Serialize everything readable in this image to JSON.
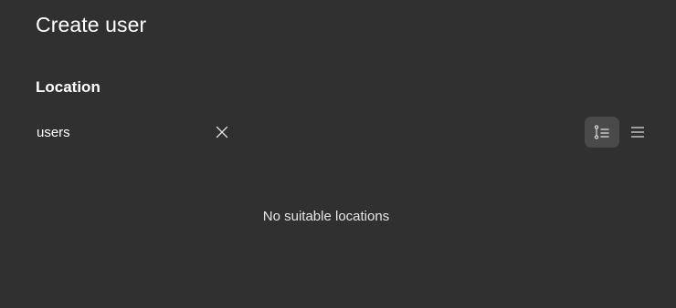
{
  "dialog": {
    "title": "Create user"
  },
  "location": {
    "heading": "Location",
    "search": {
      "value": "users",
      "placeholder": ""
    },
    "clear_icon": "close-icon",
    "view_modes": [
      {
        "name": "tree-view",
        "icon": "tree-list-icon",
        "selected": true
      },
      {
        "name": "list-view",
        "icon": "list-icon",
        "selected": false
      }
    ],
    "empty_message": "No suitable locations"
  },
  "colors": {
    "background": "#303030",
    "selected_toggle": "#4a4a4a",
    "text": "#ffffff"
  }
}
